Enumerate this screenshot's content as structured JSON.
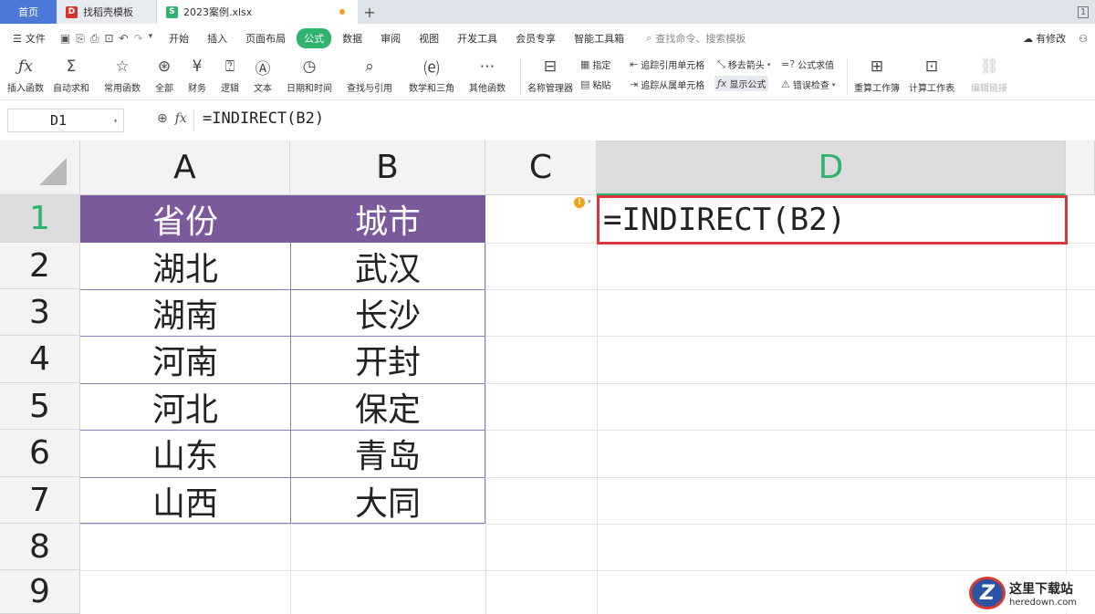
{
  "tabs": {
    "home": "首页",
    "template": "找稻壳模板",
    "file": "2023案例.xlsx",
    "add": "+",
    "restore": "1"
  },
  "menu": {
    "file": "文件",
    "items": [
      "开始",
      "插入",
      "页面布局",
      "公式",
      "数据",
      "审阅",
      "视图",
      "开发工具",
      "会员专享",
      "智能工具箱"
    ],
    "active_index": 3,
    "search": "查找命令、搜索模板",
    "changes": "有修改"
  },
  "ribbon": {
    "big": [
      {
        "label": "插入函数",
        "icon": "fx-icon"
      },
      {
        "label": "自动求和",
        "icon": "sigma-icon"
      },
      {
        "label": "常用函数",
        "icon": "star-icon"
      },
      {
        "label": "全部",
        "icon": "asterisk-icon"
      },
      {
        "label": "财务",
        "icon": "yen-icon"
      },
      {
        "label": "逻辑",
        "icon": "question-icon"
      },
      {
        "label": "文本",
        "icon": "text-a-icon"
      },
      {
        "label": "日期和时间",
        "icon": "clock-icon"
      },
      {
        "label": "查找与引用",
        "icon": "lookup-icon"
      },
      {
        "label": "数学和三角",
        "icon": "math-icon"
      },
      {
        "label": "其他函数",
        "icon": "more-icon"
      },
      {
        "label": "名称管理器",
        "icon": "name-manager-icon"
      }
    ],
    "small": {
      "specify": "指定",
      "paste": "粘贴",
      "trace_precedents": "追踪引用单元格",
      "trace_dependents": "追踪从属单元格",
      "remove_arrows": "移去箭头",
      "show_formulas": "显示公式",
      "evaluate": "公式求值",
      "error_check": "错误检查"
    },
    "calc_now": "重算工作簿",
    "calc_sheet": "计算工作表",
    "edit_links": "编辑链接"
  },
  "formula_bar": {
    "name_box": "D1",
    "formula": "=INDIRECT(B2)"
  },
  "sheet": {
    "columns": [
      "A",
      "B",
      "C",
      "D"
    ],
    "rows": [
      "1",
      "2",
      "3",
      "4",
      "5",
      "6",
      "7",
      "8",
      "9"
    ],
    "header": [
      "省份",
      "城市"
    ],
    "data": [
      [
        "湖北",
        "武汉"
      ],
      [
        "湖南",
        "长沙"
      ],
      [
        "河南",
        "开封"
      ],
      [
        "河北",
        "保定"
      ],
      [
        "山东",
        "青岛"
      ],
      [
        "山西",
        "大同"
      ]
    ],
    "active_cell_value": "=INDIRECT(B2)",
    "header_color": "#7b5a9c",
    "accent_color": "#2fb36f"
  },
  "watermark": {
    "cn": "这里下载站",
    "en": "heredown.com",
    "logo": "Z"
  }
}
